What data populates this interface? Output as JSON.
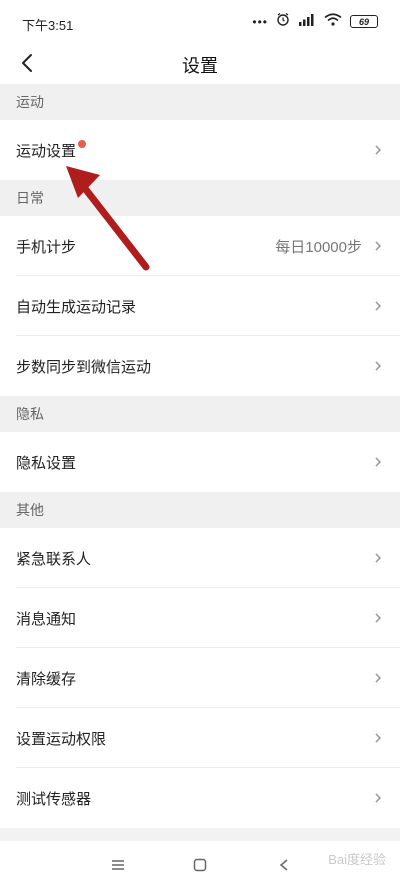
{
  "status_bar": {
    "time": "下午3:51",
    "dots": "•••",
    "battery": "69"
  },
  "header": {
    "title": "设置"
  },
  "sections": {
    "sport": "运动",
    "daily": "日常",
    "privacy": "隐私",
    "other": "其他"
  },
  "rows": {
    "sport_settings": "运动设置",
    "phone_steps": "手机计步",
    "phone_steps_value": "每日10000步",
    "auto_record": "自动生成运动记录",
    "wechat_sync": "步数同步到微信运动",
    "privacy_settings": "隐私设置",
    "emergency_contact": "紧急联系人",
    "notifications": "消息通知",
    "clear_cache": "清除缓存",
    "permissions": "设置运动权限",
    "test_sensor": "测试传感器"
  },
  "watermark": {
    "text": "Bai度经验"
  },
  "annotation": {
    "arrow_color": "#b01d1d"
  },
  "colors": {
    "badge": "#ea5c4b",
    "section_bg": "#f0f0f0"
  }
}
